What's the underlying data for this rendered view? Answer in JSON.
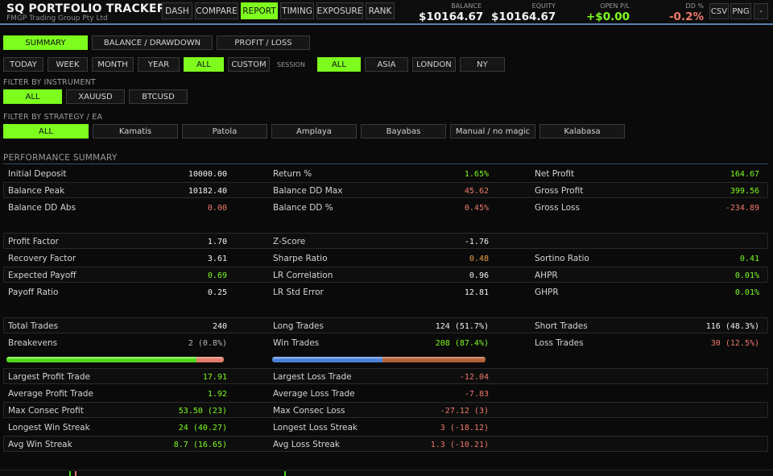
{
  "brand": {
    "title": "SQ  PORTFOLIO TRACKER",
    "subtitle": "FMGP Trading Group Pty Ltd"
  },
  "nav": [
    {
      "label": "DASH",
      "active": false
    },
    {
      "label": "COMPARE",
      "active": false
    },
    {
      "label": "REPORT",
      "active": true
    },
    {
      "label": "TIMING",
      "active": false
    },
    {
      "label": "EXPOSURE",
      "active": false
    },
    {
      "label": "RANK",
      "active": false
    }
  ],
  "stats": {
    "balance": {
      "label": "BALANCE",
      "value": "$10164.67"
    },
    "equity": {
      "label": "EQUITY",
      "value": "$10164.67"
    },
    "open_pl": {
      "label": "OPEN P/L",
      "value": "+$0.00"
    },
    "dd": {
      "label": "DD %",
      "value": "-0.2%"
    }
  },
  "header_buttons": {
    "csv": "CSV",
    "png": "PNG",
    "minimize": "-"
  },
  "report_tabs": [
    {
      "label": "SUMMARY",
      "active": true
    },
    {
      "label": "BALANCE / DRAWDOWN",
      "active": false
    },
    {
      "label": "PROFIT / LOSS",
      "active": false
    }
  ],
  "periods": [
    {
      "label": "TODAY",
      "active": false
    },
    {
      "label": "WEEK",
      "active": false
    },
    {
      "label": "MONTH",
      "active": false
    },
    {
      "label": "YEAR",
      "active": false
    },
    {
      "label": "ALL",
      "active": true
    },
    {
      "label": "CUSTOM",
      "active": false
    }
  ],
  "session_label": "SESSION",
  "sessions": [
    {
      "label": "ALL",
      "active": true
    },
    {
      "label": "ASIA",
      "active": false
    },
    {
      "label": "LONDON",
      "active": false
    },
    {
      "label": "NY",
      "active": false
    }
  ],
  "instrument_filter": {
    "label": "FILTER BY INSTRUMENT",
    "options": [
      {
        "label": "ALL",
        "active": true
      },
      {
        "label": "XAUUSD",
        "active": false
      },
      {
        "label": "BTCUSD",
        "active": false
      }
    ]
  },
  "strategy_filter": {
    "label": "FILTER BY STRATEGY / EA",
    "options": [
      {
        "label": "ALL",
        "active": true
      },
      {
        "label": "Kamatis",
        "active": false
      },
      {
        "label": "Patola",
        "active": false
      },
      {
        "label": "Amplaya",
        "active": false
      },
      {
        "label": "Bayabas",
        "active": false
      },
      {
        "label": "Manual / no magic",
        "active": false
      },
      {
        "label": "Kalabasa",
        "active": false
      }
    ]
  },
  "performance": {
    "title": "PERFORMANCE SUMMARY",
    "rows": [
      {
        "boxed": false,
        "cells": [
          {
            "k": "Initial Deposit",
            "v": "10000.00",
            "c": "white"
          },
          {
            "k": "Return %",
            "v": "1.65%",
            "c": "green"
          },
          {
            "k": "Net Profit",
            "v": "164.67",
            "c": "green"
          }
        ]
      },
      {
        "boxed": true,
        "cells": [
          {
            "k": "Balance Peak",
            "v": "10182.40",
            "c": "white"
          },
          {
            "k": "Balance DD Max",
            "v": "45.62",
            "c": "red"
          },
          {
            "k": "Gross Profit",
            "v": "399.56",
            "c": "green"
          }
        ]
      },
      {
        "boxed": false,
        "cells": [
          {
            "k": "Balance DD Abs",
            "v": "0.00",
            "c": "red"
          },
          {
            "k": "Balance DD %",
            "v": "0.45%",
            "c": "red"
          },
          {
            "k": "Gross Loss",
            "v": "-234.89",
            "c": "red"
          }
        ]
      },
      {
        "boxed": true,
        "cells": [
          {
            "k": "Profit Factor",
            "v": "1.70",
            "c": "white"
          },
          {
            "k": "Z-Score",
            "v": "-1.76",
            "c": "white"
          },
          {
            "k": "",
            "v": "",
            "c": "white"
          }
        ]
      },
      {
        "boxed": false,
        "cells": [
          {
            "k": "Recovery Factor",
            "v": "3.61",
            "c": "white"
          },
          {
            "k": "Sharpe Ratio",
            "v": "0.48",
            "c": "orange"
          },
          {
            "k": "Sortino Ratio",
            "v": "0.41",
            "c": "green"
          }
        ]
      },
      {
        "boxed": true,
        "cells": [
          {
            "k": "Expected Payoff",
            "v": "0.69",
            "c": "green"
          },
          {
            "k": "LR Correlation",
            "v": "0.96",
            "c": "white"
          },
          {
            "k": "AHPR",
            "v": "0.01%",
            "c": "green"
          }
        ]
      },
      {
        "boxed": false,
        "cells": [
          {
            "k": "Payoff Ratio",
            "v": "0.25",
            "c": "white"
          },
          {
            "k": "LR Std Error",
            "v": "12.81",
            "c": "white"
          },
          {
            "k": "GHPR",
            "v": "0.01%",
            "c": "green"
          }
        ]
      },
      {
        "boxed": true,
        "cells": [
          {
            "k": "Total Trades",
            "v": "240",
            "c": "white"
          },
          {
            "k": "Long Trades",
            "v": "124 (51.7%)",
            "c": "white"
          },
          {
            "k": "Short Trades",
            "v": "116 (48.3%)",
            "c": "white"
          }
        ]
      },
      {
        "boxed": false,
        "cells": [
          {
            "k": "Breakevens",
            "v": "2 (0.8%)",
            "c": "gray"
          },
          {
            "k": "Win Trades",
            "v": "208 (87.4%)",
            "c": "green"
          },
          {
            "k": "Loss Trades",
            "v": "30 (12.5%)",
            "c": "red"
          }
        ]
      },
      {
        "boxed": true,
        "cells": [
          {
            "k": "Largest Profit Trade",
            "v": "17.91",
            "c": "green"
          },
          {
            "k": "Largest Loss Trade",
            "v": "-12.04",
            "c": "red"
          },
          {
            "k": "",
            "v": "",
            "c": "white"
          }
        ]
      },
      {
        "boxed": false,
        "cells": [
          {
            "k": "Average Profit Trade",
            "v": "1.92",
            "c": "green"
          },
          {
            "k": "Average Loss Trade",
            "v": "-7.83",
            "c": "red"
          },
          {
            "k": "",
            "v": "",
            "c": "white"
          }
        ]
      },
      {
        "boxed": true,
        "cells": [
          {
            "k": "Max Consec Profit",
            "v": "53.50 (23)",
            "c": "green"
          },
          {
            "k": "Max Consec Loss",
            "v": "-27.12 (3)",
            "c": "red"
          },
          {
            "k": "",
            "v": "",
            "c": "white"
          }
        ]
      },
      {
        "boxed": false,
        "cells": [
          {
            "k": "Longest Win Streak",
            "v": "24 (40.27)",
            "c": "green"
          },
          {
            "k": "Longest Loss Streak",
            "v": "3 (-18.12)",
            "c": "red"
          },
          {
            "k": "",
            "v": "",
            "c": "white"
          }
        ]
      },
      {
        "boxed": true,
        "cells": [
          {
            "k": "Avg Win Streak",
            "v": "8.7 (16.65)",
            "c": "green"
          },
          {
            "k": "Avg Loss Streak",
            "v": "1.3 (-10.21)",
            "c": "red"
          },
          {
            "k": "",
            "v": "",
            "c": "white"
          }
        ]
      }
    ],
    "win_loss_bar": {
      "win_fraction": 0.874,
      "win_color": "#4cd81a",
      "loss_color": "#e07a6a"
    },
    "long_short_bar": {
      "long_fraction": 0.517,
      "long_color": "#4a7fd4",
      "short_color": "#b0603a"
    }
  },
  "colors": {
    "accent": "#7dfc1e",
    "negative": "#f07a6a",
    "warning": "#f0a040",
    "header_rule": "#5b7fb0"
  }
}
